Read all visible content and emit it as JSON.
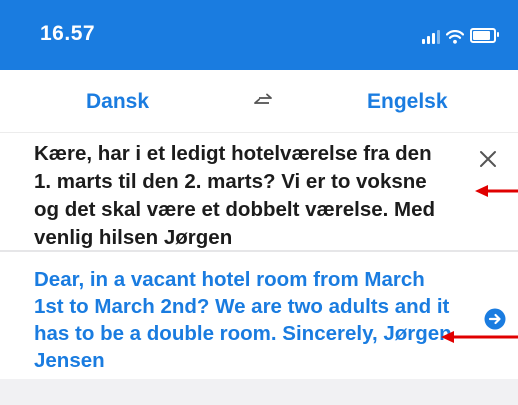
{
  "status_bar": {
    "time": "16.57",
    "icons": [
      "signal-icon",
      "wifi-icon",
      "battery-icon"
    ],
    "battery_level": 0.85
  },
  "languages": {
    "source": "Dansk",
    "target": "Engelsk",
    "swap_icon": "swap-arrows-icon"
  },
  "input": {
    "text": "Kære, har i et ledigt hotelværelse fra den 1. marts til den 2. marts?  Vi er to voksne og det skal være et dobbelt værelse. Med venlig hilsen Jørgen",
    "clear_icon": "close-icon"
  },
  "output": {
    "text": "Dear, in a vacant hotel room from March 1st to March 2nd?  We are two adults and it has to be a double room.  Sincerely, Jørgen Jensen",
    "action_icon": "arrow-right-circle-icon"
  },
  "annotations": {
    "arrow_color": "#e00000"
  },
  "colors": {
    "accent": "#1a7ce0",
    "text": "#1c1c1c",
    "annotation": "#e00000"
  }
}
